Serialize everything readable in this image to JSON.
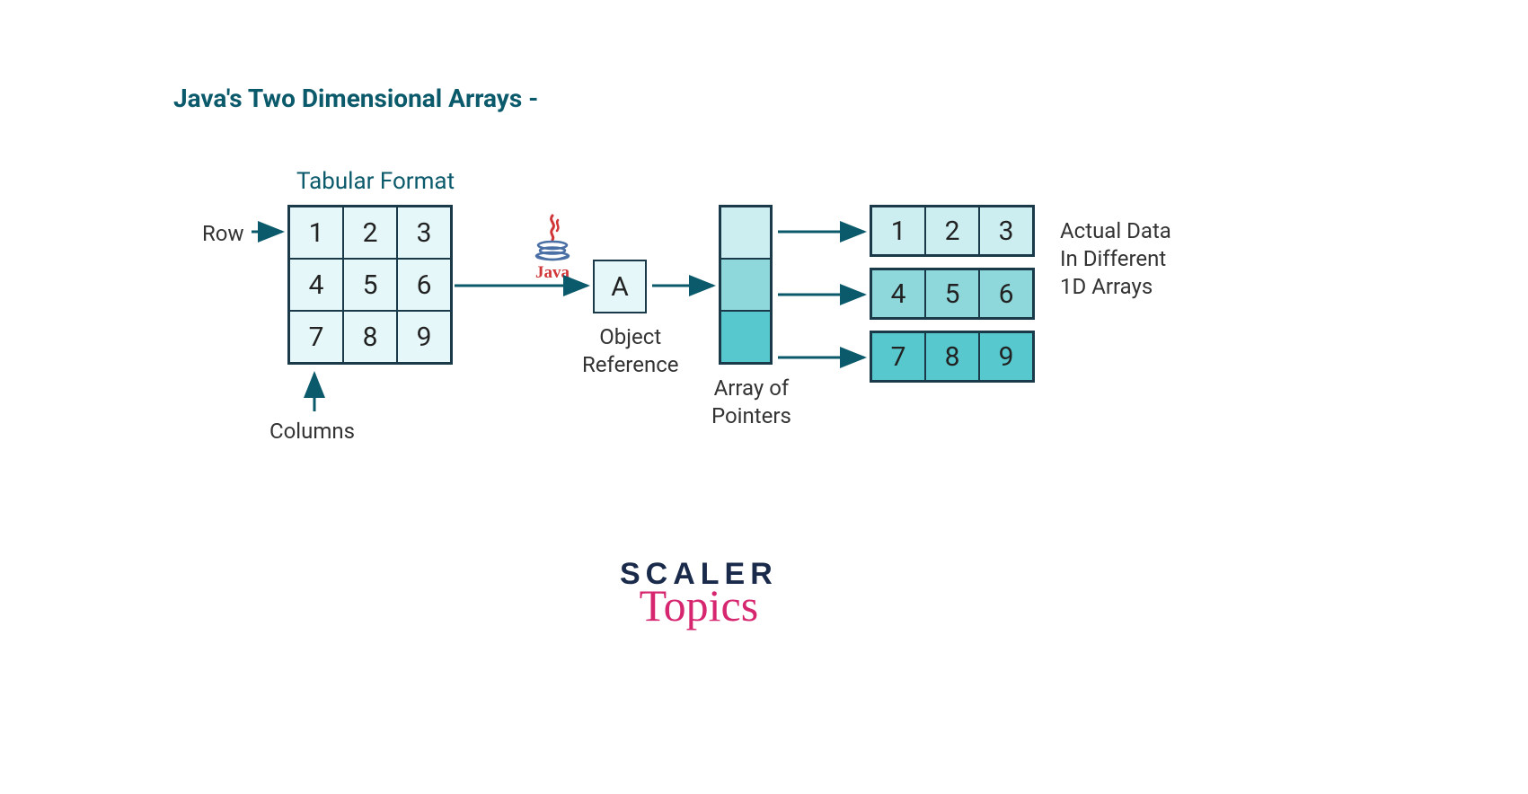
{
  "title": "Java's Two Dimensional Arrays -",
  "labels": {
    "tabular": "Tabular Format",
    "row": "Row",
    "columns": "Columns",
    "object_reference": "Object\nReference",
    "array_pointers": "Array of\nPointers",
    "actual_data": "Actual Data\nIn Different\n1D Arrays"
  },
  "table": {
    "cells": [
      "1",
      "2",
      "3",
      "4",
      "5",
      "6",
      "7",
      "8",
      "9"
    ]
  },
  "object_ref": "A",
  "arrays_1d": {
    "row1": [
      "1",
      "2",
      "3"
    ],
    "row2": [
      "4",
      "5",
      "6"
    ],
    "row3": [
      "7",
      "8",
      "9"
    ]
  },
  "java_logo": {
    "text": "Java"
  },
  "brand": {
    "scaler": "SCALER",
    "topics": "Topics"
  },
  "colors": {
    "teal_dark": "#0b5a6b",
    "cell_light": "#e6f7f9",
    "cell_mid": "#cdeef1",
    "cell_med": "#8ed7db",
    "cell_strong": "#57c8cd",
    "arrow": "#0b5a6b",
    "java_red": "#d03538",
    "pink": "#d6266f"
  }
}
